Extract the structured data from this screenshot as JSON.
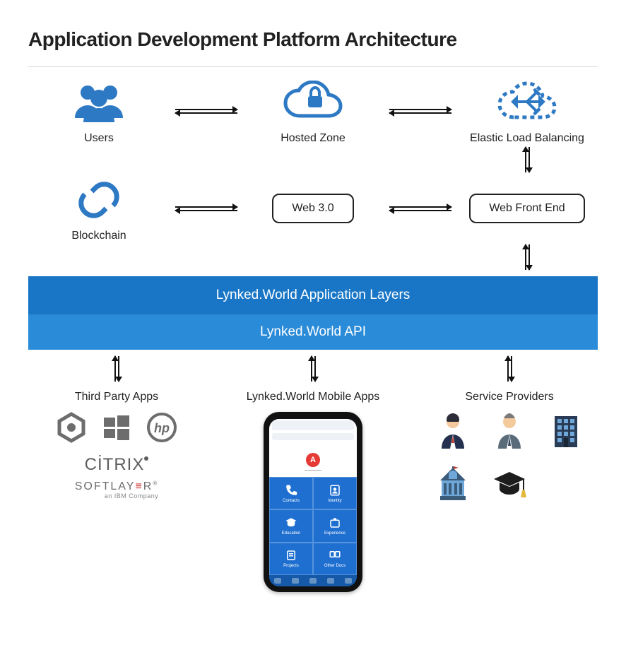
{
  "title": "Application Development Platform Architecture",
  "row1": {
    "users": "Users",
    "hosted_zone": "Hosted Zone",
    "elb": "Elastic Load Balancing"
  },
  "row2": {
    "blockchain": "Blockchain",
    "web30": "Web 3.0",
    "web_front_end": "Web Front End"
  },
  "layers": {
    "app_layers": "Lynked.World Application Layers",
    "api": "Lynked.World API"
  },
  "bottom": {
    "third_party": "Third Party Apps",
    "mobile_apps": "Lynked.World Mobile Apps",
    "service_providers": "Service Providers"
  },
  "third_party_logos": {
    "citrix": "CİTRIX",
    "softlayer_a": "SOFTLAY",
    "softlayer_b": "R",
    "softlayer_sub": "an IBM Company"
  },
  "phone": {
    "avatar": "A",
    "cells": [
      "Contacts",
      "Identity",
      "Education",
      "Experience",
      "Projects",
      "Other Docs"
    ]
  },
  "colors": {
    "brand_blue": "#1976c6",
    "icon_blue": "#2e79c4"
  }
}
